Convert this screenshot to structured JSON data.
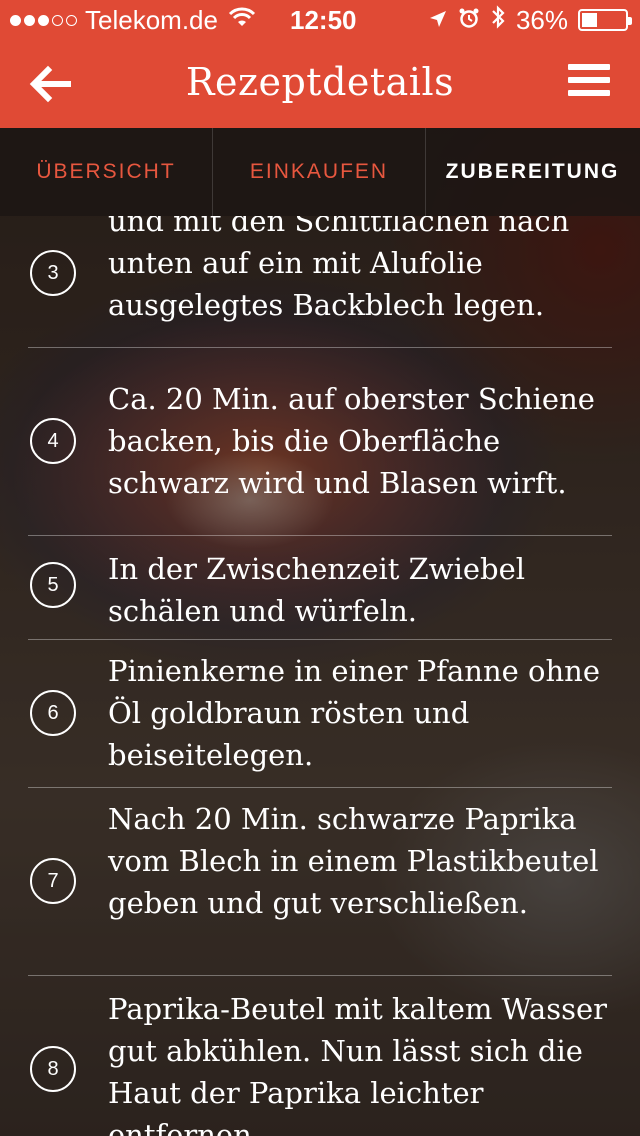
{
  "status_bar": {
    "carrier": "Telekom.de",
    "time": "12:50",
    "battery_percent": "36%",
    "battery_level": 0.36,
    "signal_bars": 3
  },
  "header": {
    "title": "Rezeptdetails",
    "back_icon": "arrow-left-icon",
    "menu_icon": "hamburger-menu-icon",
    "color": "#e04a35"
  },
  "tabs": [
    {
      "label": "ÜBERSICHT"
    },
    {
      "label": "EINKAUFEN"
    },
    {
      "label": "ZUBEREITUNG",
      "active": true
    }
  ],
  "steps": [
    {
      "number": "3",
      "text": "und mit den Schittflächen nach unten auf ein mit Alufolie ausgelegtes Backblech legen."
    },
    {
      "number": "4",
      "text": "Ca. 20 Min. auf oberster Schiene backen, bis die Oberfläche schwarz wird und Blasen wirft."
    },
    {
      "number": "5",
      "text": "In der Zwischenzeit Zwiebel schälen und würfeln."
    },
    {
      "number": "6",
      "text": "Pinienkerne in einer Pfanne ohne Öl goldbraun rösten und beiseitelegen."
    },
    {
      "number": "7",
      "text": "Nach 20 Min. schwarze Paprika vom Blech in einem Plastikbeutel geben und gut verschließen."
    },
    {
      "number": "8",
      "text": "Paprika-Beutel mit kaltem Wasser gut abkühlen. Nun lässt sich die Haut der Paprika leichter entfernen."
    }
  ]
}
